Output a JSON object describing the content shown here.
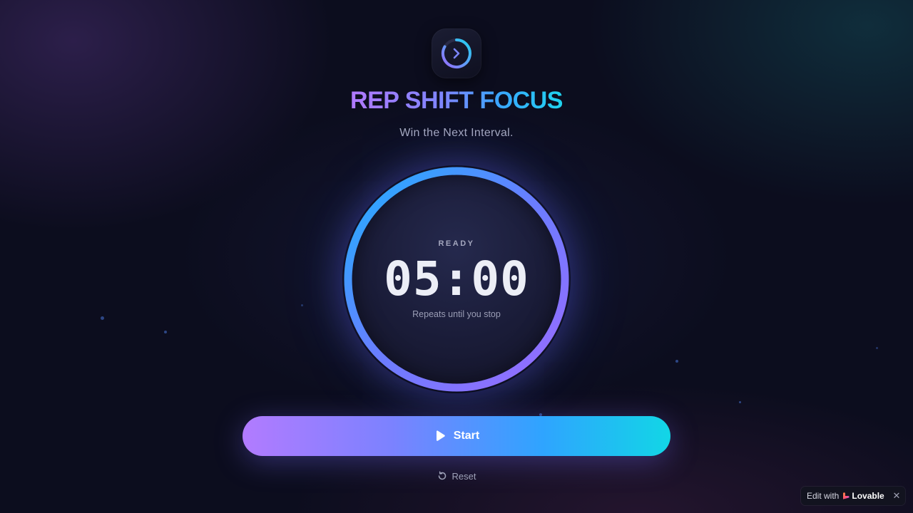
{
  "app": {
    "title": "REP SHIFT FOCUS",
    "tagline": "Win the Next Interval."
  },
  "timer": {
    "status": "READY",
    "time": "05:00",
    "note": "Repeats until you stop",
    "progress": 1.0
  },
  "controls": {
    "start_label": "Start",
    "reset_label": "Reset"
  },
  "badge": {
    "prefix": "Edit with",
    "brand": "Lovable",
    "close_symbol": "✕"
  },
  "icons": {
    "app_logo": "circular-arrow-logo-icon",
    "start": "play-icon",
    "reset": "rotate-ccw-icon",
    "brand": "heart-logo-icon",
    "close": "close-icon"
  },
  "colors": {
    "background": "#0c0d1e",
    "accent_purple": "#b27bff",
    "accent_blue": "#2fa4ff",
    "accent_cyan": "#12d6e6",
    "ring_purple": "#9b6bff",
    "ring_blue": "#2fa9ff"
  }
}
